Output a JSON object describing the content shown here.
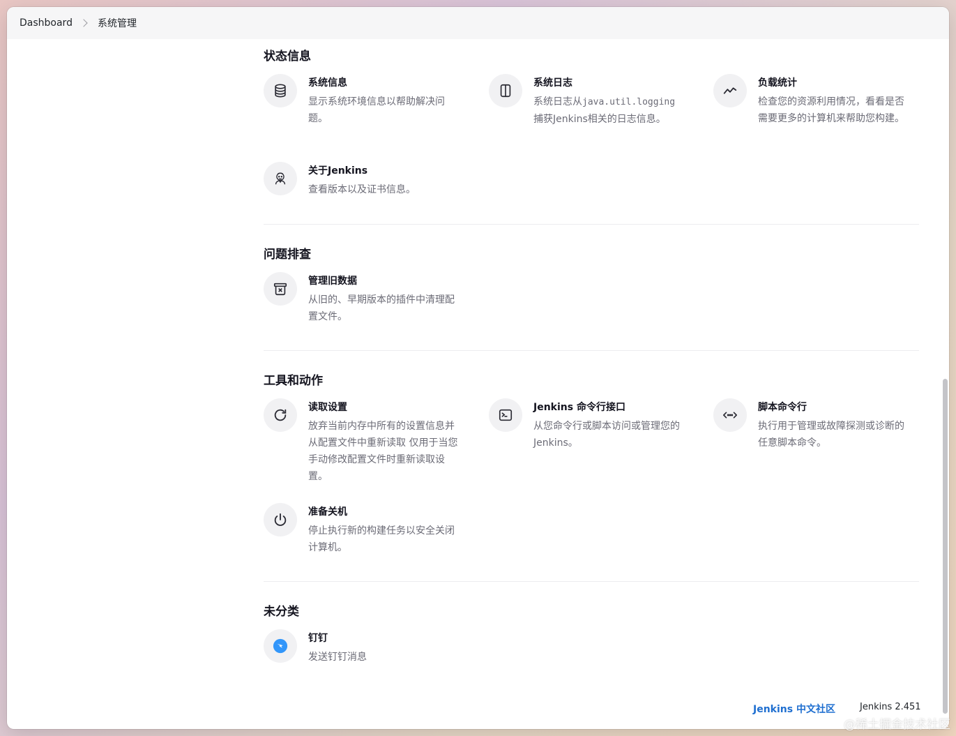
{
  "breadcrumb": {
    "home": "Dashboard",
    "current": "系统管理"
  },
  "sections": {
    "status": {
      "title": "状态信息",
      "items": [
        {
          "title": "系统信息",
          "desc": "显示系统环境信息以帮助解决问题。",
          "icon": "database-icon"
        },
        {
          "title": "系统日志",
          "desc_prefix": "系统日志从",
          "desc_mono": "java.util.logging",
          "desc_suffix": "捕获Jenkins相关的日志信息。",
          "icon": "log-panel-icon"
        },
        {
          "title": "负载统计",
          "desc": "检查您的资源利用情况，看看是否需要更多的计算机来帮助您构建。",
          "icon": "trend-line-icon"
        },
        {
          "title": "关于Jenkins",
          "desc": "查看版本以及证书信息。",
          "icon": "jenkins-butler-icon"
        }
      ]
    },
    "troubleshooting": {
      "title": "问题排查",
      "items": [
        {
          "title": "管理旧数据",
          "desc": "从旧的、早期版本的插件中清理配置文件。",
          "icon": "archive-x-icon"
        }
      ]
    },
    "tools": {
      "title": "工具和动作",
      "items": [
        {
          "title": "读取设置",
          "desc": "放弃当前内存中所有的设置信息并从配置文件中重新读取 仅用于当您手动修改配置文件时重新读取设置。",
          "icon": "reload-icon"
        },
        {
          "title": "Jenkins 命令行接口",
          "desc": "从您命令行或脚本访问或管理您的Jenkins。",
          "icon": "terminal-icon"
        },
        {
          "title": "脚本命令行",
          "desc": "执行用于管理或故障探测或诊断的任意脚本命令。",
          "icon": "code-icon"
        },
        {
          "title": "准备关机",
          "desc": "停止执行新的构建任务以安全关闭计算机。",
          "icon": "power-icon"
        }
      ]
    },
    "uncategorized": {
      "title": "未分类",
      "items": [
        {
          "title": "钉钉",
          "desc": "发送钉钉消息",
          "icon": "dingtalk-icon"
        }
      ]
    }
  },
  "footer": {
    "community_link": "Jenkins 中文社区",
    "version": "Jenkins 2.451"
  },
  "watermark": "@稀土掘金技术社区",
  "colors": {
    "link": "#1f6fd0",
    "dingtalk": "#3296fa"
  }
}
